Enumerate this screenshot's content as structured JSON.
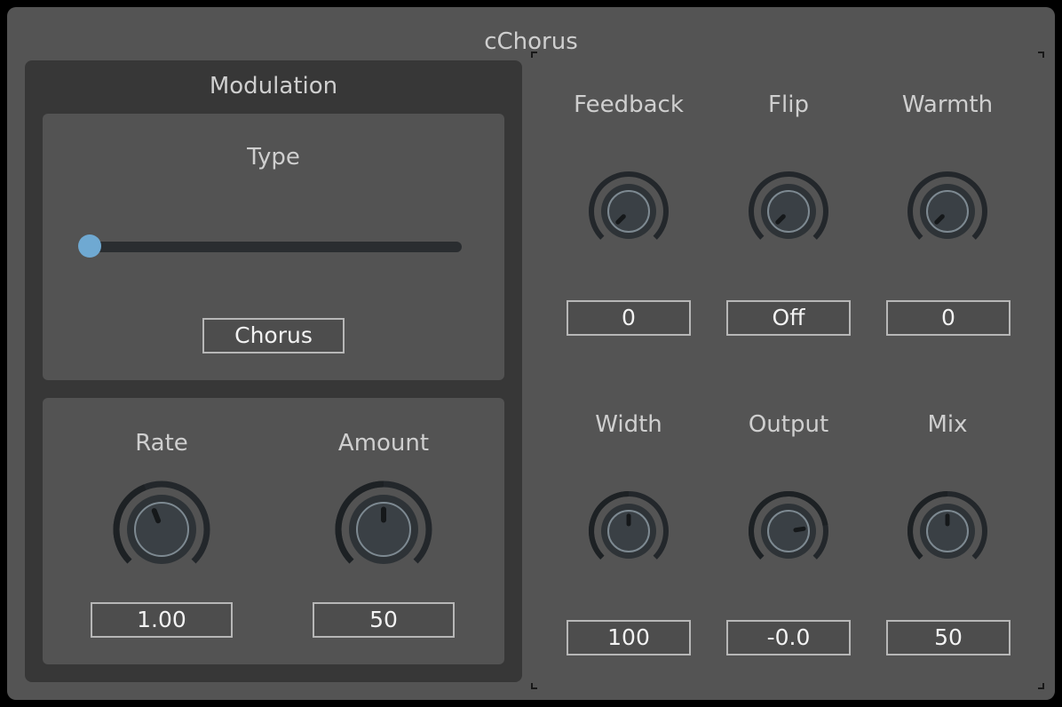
{
  "title": "cChorus",
  "modulation": {
    "title": "Modulation",
    "type": {
      "label": "Type",
      "slider_value": 0,
      "value": "Chorus"
    },
    "rate": {
      "label": "Rate",
      "value": "1.00",
      "level": 0.42
    },
    "amount": {
      "label": "Amount",
      "value": "50",
      "level": 0.5
    }
  },
  "knobs": {
    "feedback": {
      "label": "Feedback",
      "value": "0",
      "level": 0.0
    },
    "flip": {
      "label": "Flip",
      "value": "Off",
      "level": 0.0
    },
    "warmth": {
      "label": "Warmth",
      "value": "0",
      "level": 0.0
    },
    "width": {
      "label": "Width",
      "value": "100",
      "level": 0.5
    },
    "output": {
      "label": "Output",
      "value": "-0.0",
      "level": 0.8
    },
    "mix": {
      "label": "Mix",
      "value": "50",
      "level": 0.5
    }
  },
  "colors": {
    "background": "#545454",
    "panel_dark": "#373737",
    "panel": "#535353",
    "accent": "#6fa9d2",
    "arc": "#23272b",
    "knob": "#3a4045"
  }
}
